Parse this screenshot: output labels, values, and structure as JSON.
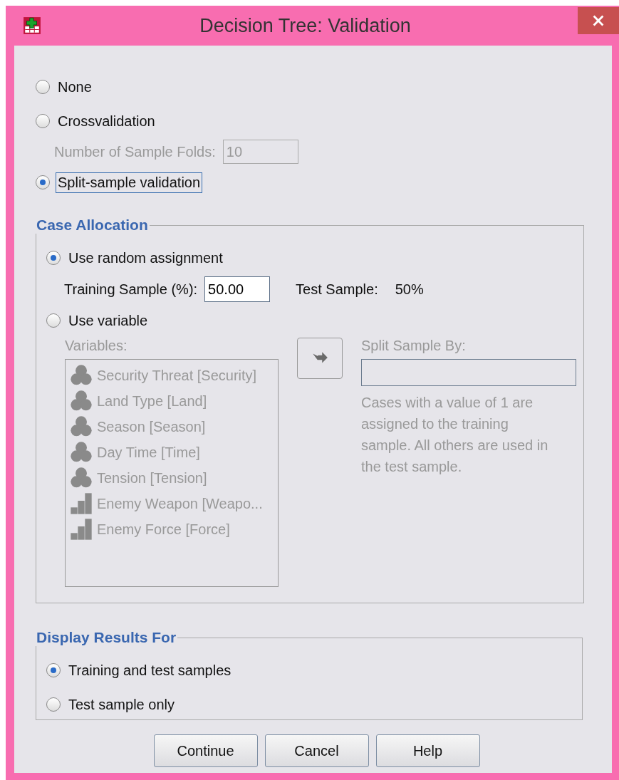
{
  "window": {
    "title": "Decision Tree: Validation"
  },
  "validation_options": [
    {
      "label": "None",
      "selected": false
    },
    {
      "label": "Crossvalidation",
      "selected": false
    },
    {
      "label": "Split-sample validation",
      "selected": true
    }
  ],
  "sample_folds": {
    "label": "Number of Sample Folds:",
    "value": "10",
    "disabled": true
  },
  "case_allocation": {
    "title": "Case Allocation",
    "options": [
      {
        "label": "Use random assignment",
        "selected": true
      },
      {
        "label": "Use variable",
        "selected": false
      }
    ],
    "training_sample": {
      "label": "Training Sample (%):",
      "value": "50.00"
    },
    "test_sample": {
      "label": "Test Sample:",
      "value": "50%"
    },
    "variables": {
      "label": "Variables:",
      "disabled": true,
      "items": [
        {
          "name": "Security Threat [Security]",
          "kind": "nominal"
        },
        {
          "name": "Land Type [Land]",
          "kind": "nominal"
        },
        {
          "name": "Season [Season]",
          "kind": "nominal"
        },
        {
          "name": "Day Time [Time]",
          "kind": "nominal"
        },
        {
          "name": "Tension [Tension]",
          "kind": "nominal"
        },
        {
          "name": "Enemy Weapon [Weapo...",
          "kind": "scale"
        },
        {
          "name": "Enemy  Force [Force]",
          "kind": "scale"
        }
      ]
    },
    "split_sample_by": {
      "label": "Split Sample By:",
      "note": "Cases with a value of 1 are assigned to the training sample. All others are used in the test sample."
    }
  },
  "display_results": {
    "title": "Display Results For",
    "options": [
      {
        "label": "Training and test samples",
        "selected": true
      },
      {
        "label": "Test sample only",
        "selected": false
      }
    ]
  },
  "buttons": [
    "Continue",
    "Cancel",
    "Help"
  ]
}
